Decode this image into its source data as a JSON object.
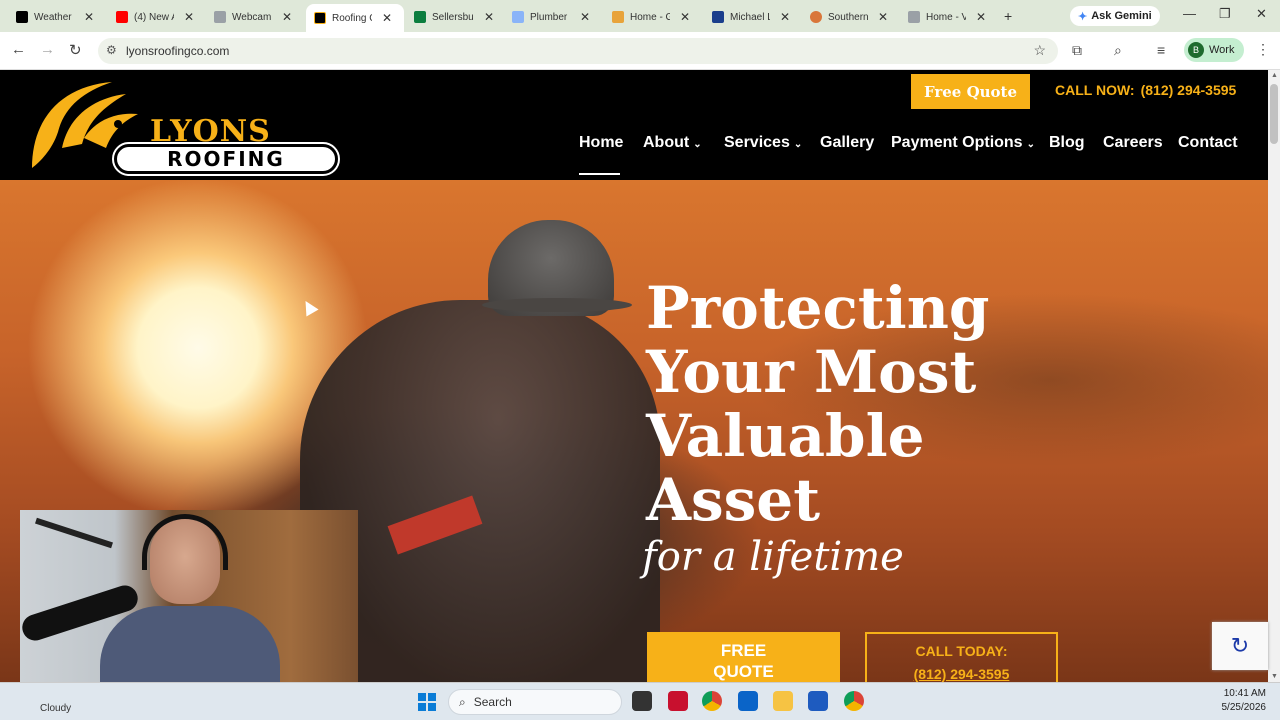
{
  "browser": {
    "tabs": [
      {
        "title": "Weather",
        "favicon_color": "#000000"
      },
      {
        "title": "(4) New A",
        "favicon_color": "#ff0000"
      },
      {
        "title": "Webcam",
        "favicon_color": "#9aa0a6"
      },
      {
        "title": "Roofing C",
        "favicon_color": "#000000",
        "active": true
      },
      {
        "title": "Sellersbur",
        "favicon_color": "#0b7d3e"
      },
      {
        "title": "Plumber",
        "favicon_color": "#8ab4f8"
      },
      {
        "title": "Home - G",
        "favicon_color": "#e8a33a"
      },
      {
        "title": "Michael L",
        "favicon_color": "#1a3e8c"
      },
      {
        "title": "Southern",
        "favicon_color": "#d9763a"
      },
      {
        "title": "Home - V",
        "favicon_color": "#9aa0a6"
      }
    ],
    "ask_gemini": "Ask Gemini",
    "url": "lyonsroofingco.com",
    "profile_initial": "B",
    "profile_label": "Work"
  },
  "site": {
    "logo_word1": "LYONS",
    "logo_word2": "ROOFING",
    "free_quote_label": "Free Quote",
    "call_now_label": "CALL NOW:",
    "call_now_phone": "(812) 294-3595",
    "nav": [
      {
        "label": "Home",
        "dropdown": false
      },
      {
        "label": "About",
        "dropdown": true
      },
      {
        "label": "Services",
        "dropdown": true
      },
      {
        "label": "Gallery",
        "dropdown": false
      },
      {
        "label": "Payment Options",
        "dropdown": true
      },
      {
        "label": "Blog",
        "dropdown": false
      },
      {
        "label": "Careers",
        "dropdown": false
      },
      {
        "label": "Contact",
        "dropdown": false
      }
    ],
    "hero": {
      "line1": "Protecting",
      "line2": "Your Most",
      "line3": "Valuable",
      "line4": "Asset",
      "script": "for a lifetime",
      "btn_quote_line1": "FREE",
      "btn_quote_line2": "QUOTE",
      "btn_call_line1": "CALL TODAY:",
      "btn_call_phone": "(812) 294-3595"
    },
    "accent_color": "#f7b118"
  },
  "taskbar": {
    "weather": "Cloudy",
    "search_placeholder": "Search",
    "time": "10:41 AM",
    "date": "5/25/2026"
  }
}
